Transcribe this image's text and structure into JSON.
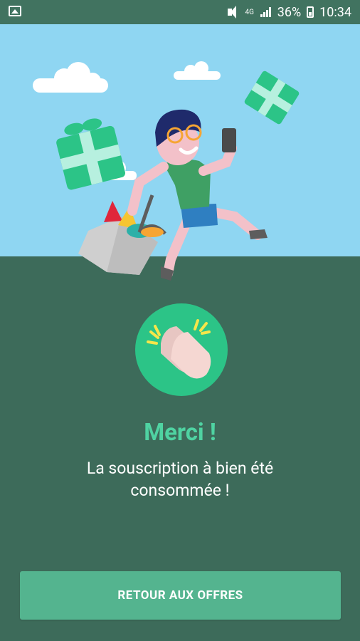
{
  "statusbar": {
    "network": "4G",
    "battery": "36%",
    "time": "10:34"
  },
  "illustration": {
    "icons": [
      "gift-icon",
      "cloud-icon",
      "shopping-bag-icon",
      "phone-icon",
      "character-illustration"
    ]
  },
  "success": {
    "icon": "clapping-hands-icon",
    "title": "Merci !",
    "message_line1": "La souscription à bien été",
    "message_line2": "consommée !"
  },
  "button": {
    "label": "RETOUR AUX OFFRES"
  },
  "colors": {
    "sky": "#8fd6f2",
    "ground": "#3d6b5a",
    "accent": "#4fd3a2",
    "button": "#54b48f",
    "badge": "#2cc487"
  }
}
